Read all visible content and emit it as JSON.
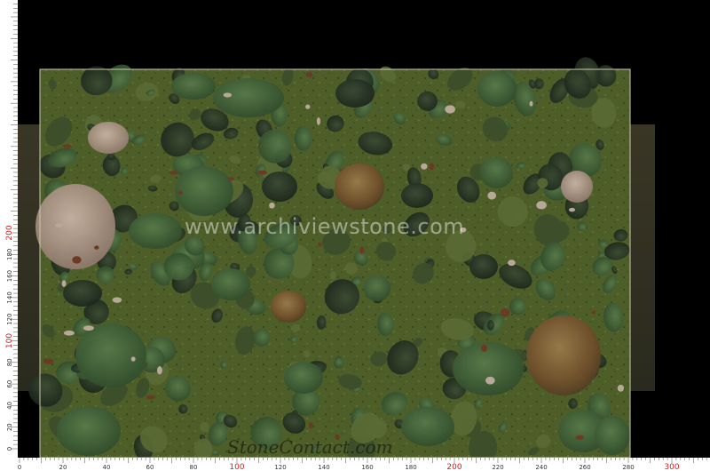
{
  "watermark": "www.archiviewstone.com",
  "bottom_watermark": "StoneContact.com",
  "ruler": {
    "left_labels": [
      "200",
      "180",
      "160",
      "140",
      "120",
      "100",
      "80",
      "60",
      "40",
      "20",
      "0"
    ],
    "bottom_labels": [
      "0",
      "20",
      "40",
      "60",
      "80",
      "100",
      "120",
      "140",
      "160",
      "180",
      "200",
      "220",
      "240",
      "260",
      "280",
      "300"
    ],
    "highlight_labels": [
      "100",
      "200",
      "300"
    ],
    "highlight_color": "#d02020"
  },
  "colors": {
    "background": "#000000",
    "slab_base": "#4a5a26",
    "pebble_dark": "#2a3a22",
    "pebble_green": "#3f5a36"
  }
}
